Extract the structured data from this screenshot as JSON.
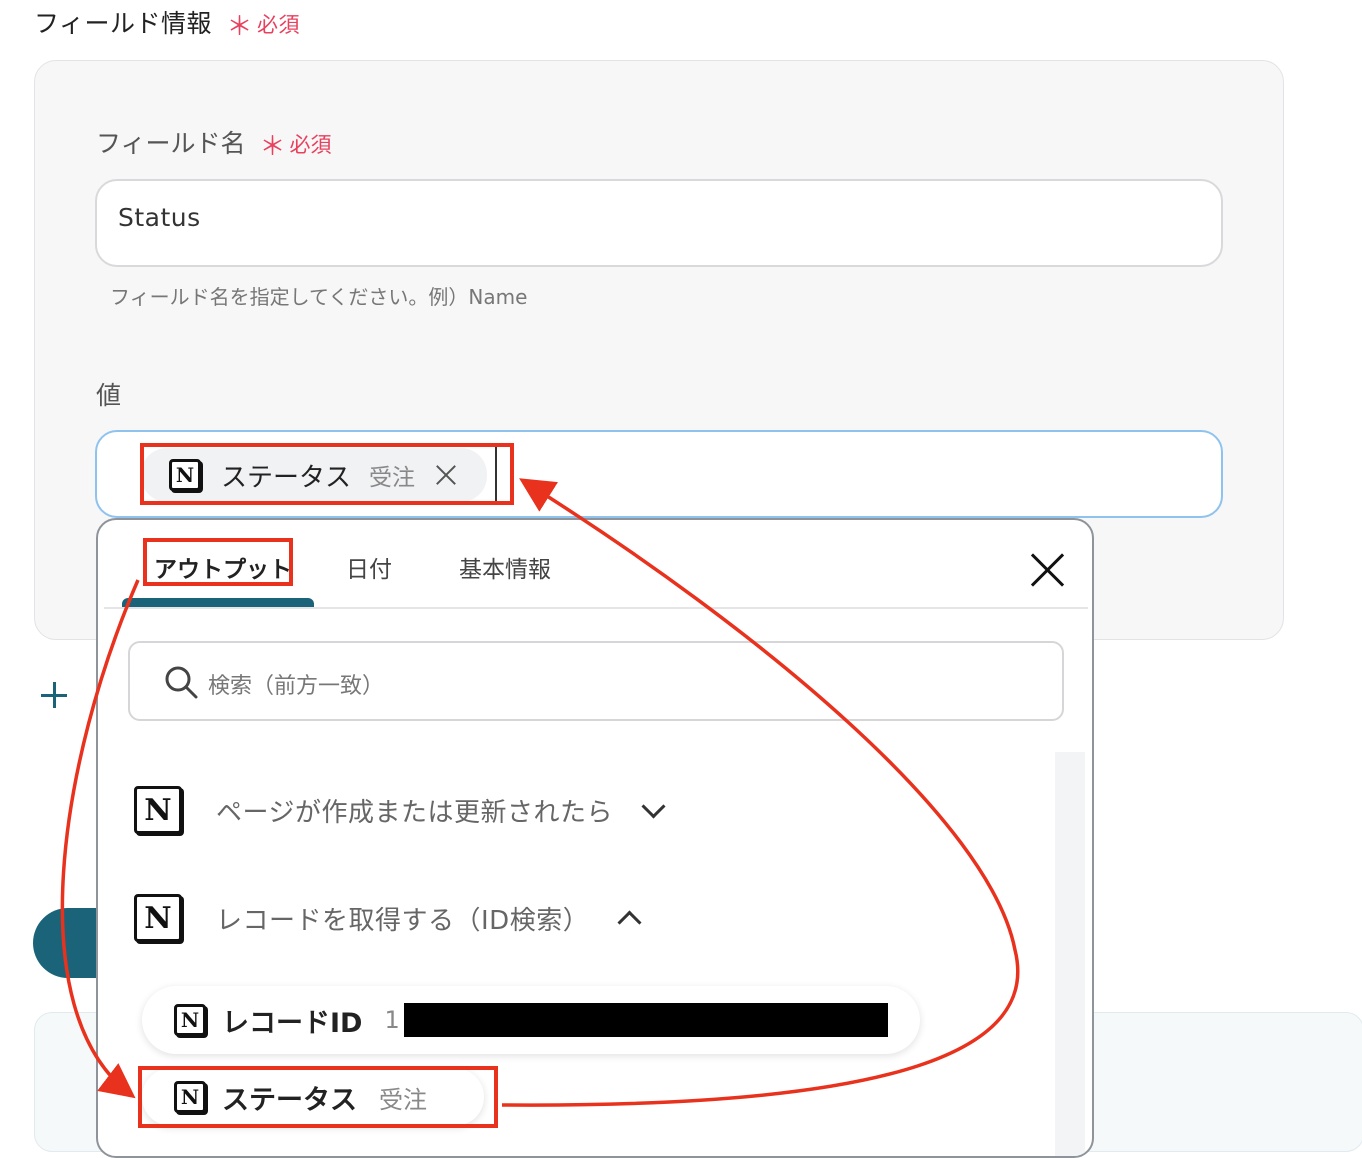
{
  "section": {
    "title": "フィールド情報",
    "required_label": "必須",
    "required_mark": "＊"
  },
  "field_name": {
    "label": "フィールド名",
    "required_label": "必須",
    "value": "Status",
    "helper": "フィールド名を指定してください。例）Name"
  },
  "value_field": {
    "label": "値",
    "chip": {
      "title": "ステータス",
      "value": "受注",
      "icon": "notion-icon"
    }
  },
  "popup": {
    "tabs": [
      {
        "label": "アウトプット",
        "active": true
      },
      {
        "label": "日付",
        "active": false
      },
      {
        "label": "基本情報",
        "active": false
      }
    ],
    "search_placeholder": "検索（前方一致）",
    "groups": [
      {
        "label": "ページが作成または更新されたら",
        "expanded": false,
        "icon": "notion-icon"
      },
      {
        "label": "レコードを取得する（ID検索）",
        "expanded": true,
        "icon": "notion-icon"
      }
    ],
    "items": [
      {
        "title": "レコードID",
        "value": "1",
        "redacted": true,
        "icon": "notion-icon"
      },
      {
        "title": "ステータス",
        "value": "受注",
        "icon": "notion-icon"
      }
    ]
  },
  "icons": {
    "logo_letter": "N"
  },
  "colors": {
    "accent": "#1b6378",
    "required": "#e8405d",
    "annotation": "#e8321e",
    "value_border": "#8fc3ee"
  }
}
